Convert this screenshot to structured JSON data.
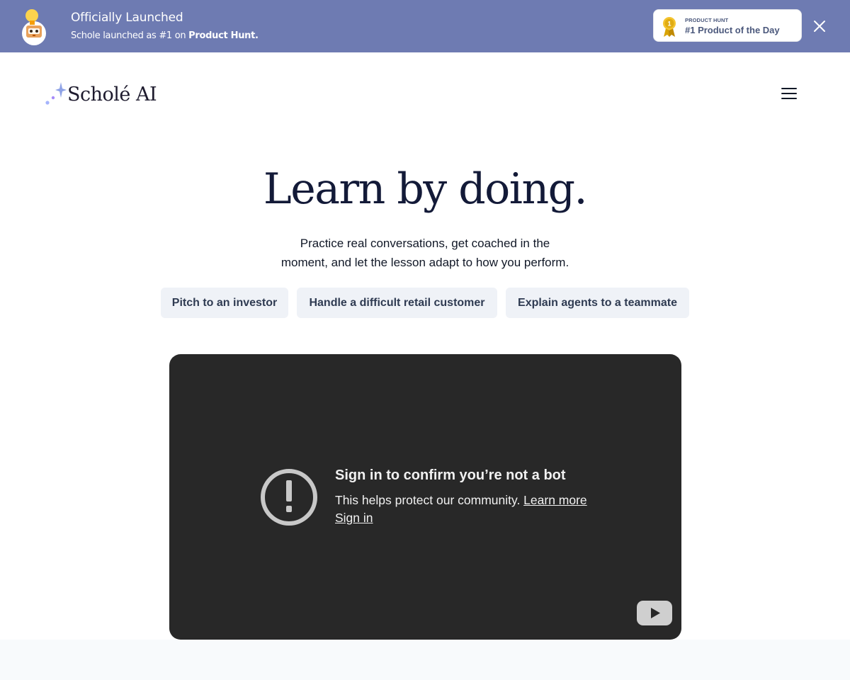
{
  "banner": {
    "title": "Officially Launched",
    "subtitle_prefix": "Schole launched as #1 on ",
    "subtitle_bold": "Product Hunt.",
    "badge": {
      "kicker": "PRODUCT HUNT",
      "title": "#1 Product of the Day",
      "medal_number": "1"
    },
    "close_icon": "close-icon",
    "color": "#6e7bb2"
  },
  "nav": {
    "logo_text": "Scholé AI",
    "menu_icon": "hamburger-menu-icon"
  },
  "hero": {
    "title": "Learn by doing.",
    "subtitle_line1": "Practice real conversations, get coached in the",
    "subtitle_line2": "moment, and let the lesson adapt to how you perform."
  },
  "scenarios": [
    {
      "label": "Pitch to an investor"
    },
    {
      "label": "Handle a difficult retail customer"
    },
    {
      "label": "Explain agents to a teammate"
    }
  ],
  "video": {
    "title": "Sign in to confirm you’re not a bot",
    "message": "This helps protect our community. ",
    "learn_more": "Learn more",
    "sign_in": "Sign in",
    "icons": [
      "exclamation-circle-icon",
      "youtube-logo-icon"
    ]
  }
}
